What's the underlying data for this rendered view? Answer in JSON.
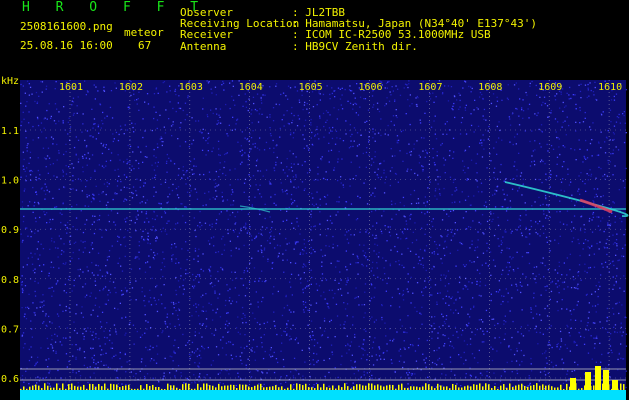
{
  "header": {
    "app_title": "H R O F F T",
    "file_name": "2508161600.png",
    "timestamp": "25.08.16 16:00",
    "mode_label": "meteor",
    "meteor_count": "67",
    "info": [
      {
        "label": "Observer",
        "value": ": JL2TBB"
      },
      {
        "label": "Receiving Location",
        "value": ": Hamamatsu, Japan (N34°40' E137°43')"
      },
      {
        "label": "Receiver",
        "value": ": ICOM IC-R2500 53.1000MHz USB"
      },
      {
        "label": "Antenna",
        "value": ": HB9CV Zenith dir."
      }
    ]
  },
  "axes": {
    "y_unit": "kHz",
    "y_ticks": [
      "1.1",
      "1.0",
      "0.9",
      "0.8",
      "0.7",
      "0.6"
    ],
    "x_ticks": [
      "1601",
      "1602",
      "1603",
      "1604",
      "1605",
      "1606",
      "1607",
      "1608",
      "1609",
      "1610"
    ]
  },
  "colors": {
    "background": "#000000",
    "noise_blue": "#1414a0",
    "signal_cyan": "#30d0d0",
    "meteor_red": "#e84060",
    "bottom_bar": "#00e0ff",
    "level_yellow": "#ffff00",
    "label_yellow": "#f2f200",
    "label_green": "#19e619"
  }
}
